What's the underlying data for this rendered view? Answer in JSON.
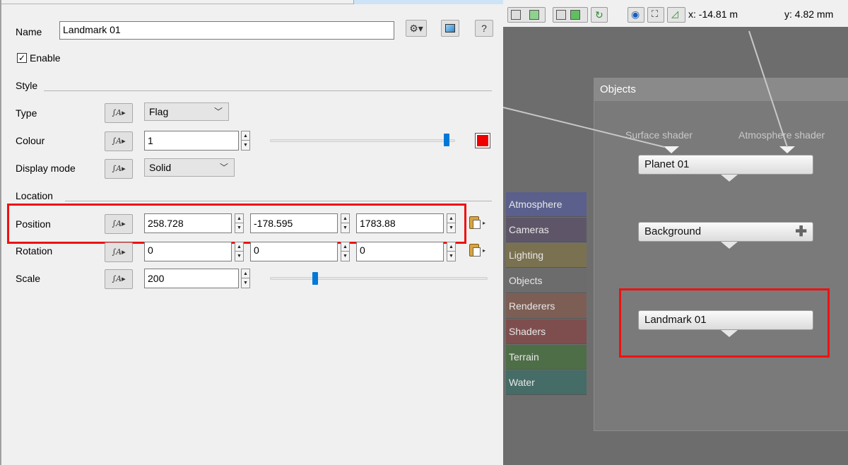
{
  "name_field": {
    "label": "Name",
    "value": "Landmark 01"
  },
  "enable": {
    "label": "Enable",
    "checked": true
  },
  "style_section": "Style",
  "location_section": "Location",
  "icons": {
    "settings": "gear-icon",
    "preview": "preview-icon",
    "help": "?"
  },
  "type_row": {
    "label": "Type",
    "value": "Flag"
  },
  "colour_row": {
    "label": "Colour",
    "value": "1",
    "swatch_color": "#ee0000",
    "slider_fraction": 0.97
  },
  "display_mode_row": {
    "label": "Display mode",
    "value": "Solid"
  },
  "position_row": {
    "label": "Position",
    "x": "258.728",
    "y": "-178.595",
    "z": "1783.88"
  },
  "rotation_row": {
    "label": "Rotation",
    "x": "0",
    "y": "0",
    "z": "0"
  },
  "scale_row": {
    "label": "Scale",
    "value": "200",
    "slider_fraction": 0.2
  },
  "anim_glyph": "∫A▸",
  "viewport": {
    "x_readout": "x: -14.81 m",
    "y_readout": "y: 4.82 mm"
  },
  "categories": [
    {
      "label": "Atmosphere",
      "color": "#5a5f8c"
    },
    {
      "label": "Cameras",
      "color": "#5e5668"
    },
    {
      "label": "Lighting",
      "color": "#7a7150"
    },
    {
      "label": "Objects",
      "color": "#6c6c6c"
    },
    {
      "label": "Renderers",
      "color": "#7d5e54"
    },
    {
      "label": "Shaders",
      "color": "#7e4e4e"
    },
    {
      "label": "Terrain",
      "color": "#4e6e47"
    },
    {
      "label": "Water",
      "color": "#456c66"
    }
  ],
  "objects_panel": {
    "title": "Objects",
    "ports": {
      "surface": "Surface shader",
      "atmosphere": "Atmosphere shader"
    },
    "nodes": {
      "planet": "Planet 01",
      "background": "Background",
      "landmark": "Landmark 01"
    }
  },
  "highlight_color": "#ee1111"
}
